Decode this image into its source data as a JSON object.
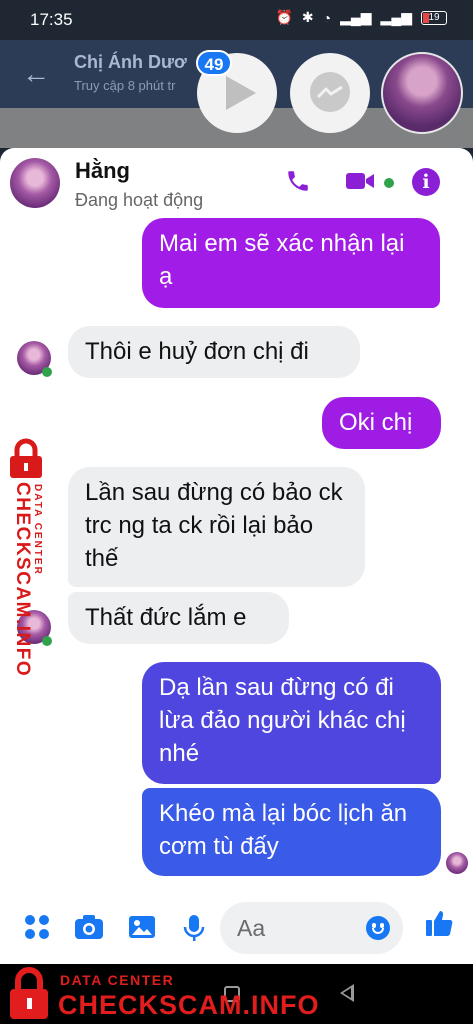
{
  "status_bar": {
    "time": "17:35",
    "battery": "19"
  },
  "background_chat": {
    "back_icon": "arrow-left-icon",
    "name": "Chị Ánh Dươ",
    "subtitle": "Truy cập 8 phút tr"
  },
  "chat_heads": {
    "unread_count": "49"
  },
  "chat": {
    "contact_name": "Hằng",
    "contact_status": "Đang hoạt động",
    "accent": "#a11ce6",
    "messages": [
      {
        "side": "out",
        "text": "Mai em sẽ xác nhận lại ạ"
      },
      {
        "side": "in",
        "text": "Thôi e huỷ đơn chị đi"
      },
      {
        "side": "out",
        "text": "Oki chị"
      },
      {
        "side": "in",
        "text": "Lần sau đừng có bảo ck trc ng ta ck rồi lại bảo thế"
      },
      {
        "side": "in",
        "text": "Thất đức lắm e"
      },
      {
        "side": "out",
        "text": "Dạ lần sau đừng có đi lừa đảo người khác chị nhé"
      },
      {
        "side": "out",
        "text": "Khéo mà lại bóc lịch ăn cơm tù đấy"
      }
    ]
  },
  "composer": {
    "placeholder": "Aa"
  },
  "watermark": {
    "small": "DATA CENTER",
    "big": "CHECKSCAM.INFO"
  }
}
